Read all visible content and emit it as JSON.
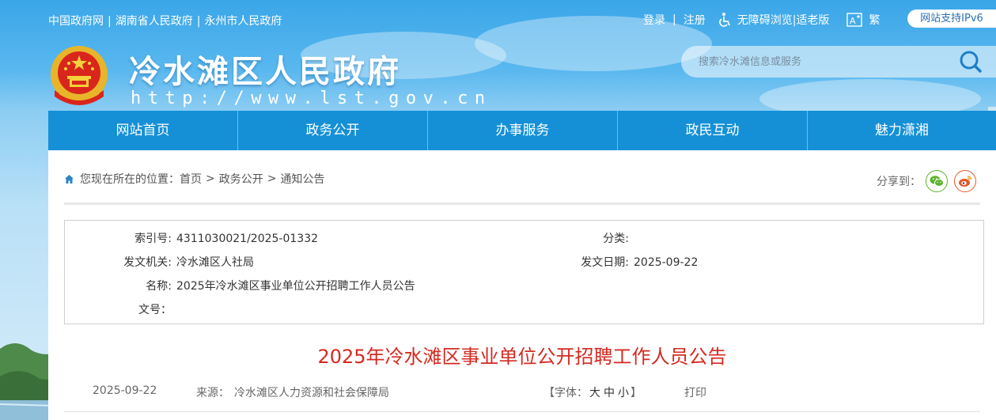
{
  "top_links": [
    "中国政府网",
    "湖南省人民政府",
    "永州市人民政府"
  ],
  "top_separator": "|",
  "user": {
    "login": "登录",
    "sep": "|",
    "register": "注册"
  },
  "accessibility": {
    "barrier_free": "无障碍浏览|",
    "elderly": "适老版"
  },
  "lang_toggle": "繁",
  "ipv6_badge": "网站支持IPv6",
  "site": {
    "title": "冷水滩区人民政府",
    "url": "http://www.lst.gov.cn"
  },
  "search": {
    "placeholder": "搜索冷水滩信息或服务"
  },
  "nav": [
    "网站首页",
    "政务公开",
    "办事服务",
    "政民互动",
    "魅力潇湘"
  ],
  "breadcrumb": {
    "prefix": "您现在所在的位置：",
    "items": [
      "首页",
      "政务公开",
      "通知公告"
    ],
    "arrow": ">"
  },
  "share": {
    "label": "分享到："
  },
  "meta": {
    "index_label": "索引号:",
    "index_value": "4311030021/2025-01332",
    "category_label": "分类:",
    "category_value": "",
    "issuer_label": "发文机关:",
    "issuer_value": "冷水滩区人社局",
    "date_label": "发文日期:",
    "date_value": "2025-09-22",
    "name_label": "名称:",
    "name_value": "2025年冷水滩区事业单位公开招聘工作人员公告",
    "docno_label": "文号：",
    "docno_value": ""
  },
  "article": {
    "title": "2025年冷水滩区事业单位公开招聘工作人员公告",
    "date": "2025-09-22",
    "source_label": "来源：",
    "source_value": "冷水滩区人力资源和社会保障局",
    "font_label_open": "【字体：",
    "font_large": "大",
    "font_medium": "中",
    "font_small": "小",
    "font_label_close": "】",
    "print": "打印"
  },
  "colors": {
    "nav_bg": "#1590d6",
    "title_red": "#d42a20",
    "sky": "#3aa6e8"
  },
  "icons": [
    "accessibility-icon",
    "elderly-mode-icon",
    "search-icon",
    "home-icon",
    "wechat-icon",
    "weibo-icon",
    "national-emblem-icon"
  ]
}
